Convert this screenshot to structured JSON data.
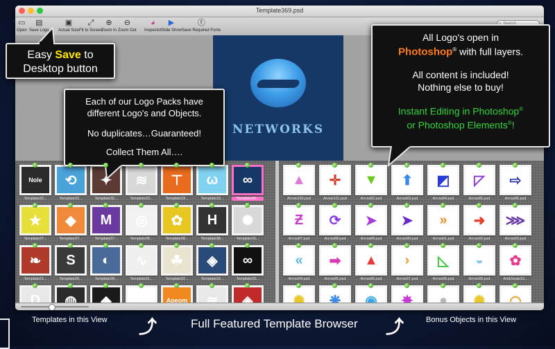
{
  "window": {
    "title": "Template369.psd",
    "search_placeholder": "Search",
    "traffic_lights": {
      "close": "#ff5f57",
      "minimize": "#ffbd2e",
      "zoom": "#28c840"
    }
  },
  "toolbar": {
    "buttons": [
      {
        "label": "Open",
        "icon": "folder-icon"
      },
      {
        "label": "Save Logo",
        "icon": "save-icon"
      },
      {
        "label": "Actual Size",
        "icon": "actual-size-icon"
      },
      {
        "label": "Fit to Screen",
        "icon": "fit-screen-icon"
      },
      {
        "label": "Zoom In",
        "icon": "zoom-in-icon"
      },
      {
        "label": "Zoom Out",
        "icon": "zoom-out-icon"
      },
      {
        "label": "Inspector",
        "icon": "inspector-icon"
      },
      {
        "label": "Slide Show",
        "icon": "slideshow-icon"
      },
      {
        "label": "Save Required Fonts",
        "icon": "fonts-icon"
      }
    ]
  },
  "preview": {
    "logo_text": "NETWORKS",
    "background": "#163866"
  },
  "templates": [
    {
      "caption": "Template32...",
      "color": "#2a2a2a",
      "glyph": "Nole"
    },
    {
      "caption": "Template32...",
      "color": "#4aa3d8",
      "glyph": "⟲"
    },
    {
      "caption": "Template32...",
      "color": "#5a3a33",
      "glyph": "✦"
    },
    {
      "caption": "Template33...",
      "color": "#d8d8d8",
      "glyph": "≋"
    },
    {
      "caption": "Template33...",
      "color": "#e86b1e",
      "glyph": "⊤"
    },
    {
      "caption": "Template33...",
      "color": "#7fd3f0",
      "glyph": "ω"
    },
    {
      "caption": "Template36...",
      "color": "#163866",
      "glyph": "∞",
      "selected": true
    },
    {
      "caption": "Template37...",
      "color": "#e8e03a",
      "glyph": "★"
    },
    {
      "caption": "Template37...",
      "color": "#f08a3a",
      "glyph": "◆"
    },
    {
      "caption": "Template37...",
      "color": "#6a3aa0",
      "glyph": "M"
    },
    {
      "caption": "Template38...",
      "color": "#f2f2f2",
      "glyph": "◎"
    },
    {
      "caption": "Template38...",
      "color": "#e8c820",
      "glyph": "✿"
    },
    {
      "caption": "Template38...",
      "color": "#333333",
      "glyph": "H"
    },
    {
      "caption": "Template15...",
      "color": "#d8d8d8",
      "glyph": "✺"
    },
    {
      "caption": "Template21...",
      "color": "#b03a2a",
      "glyph": "❧"
    },
    {
      "caption": "Template26...",
      "color": "#3a3a3a",
      "glyph": "S"
    },
    {
      "caption": "Template28...",
      "color": "#4a6a9a",
      "glyph": "◐"
    },
    {
      "caption": "Template31...",
      "color": "#f0f0f0",
      "glyph": "∿"
    },
    {
      "caption": "Template32...",
      "color": "#e8e4d0",
      "glyph": "☘"
    },
    {
      "caption": "Template32...",
      "color": "#2a4a7a",
      "glyph": "◈"
    },
    {
      "caption": "Template33...",
      "color": "#111111",
      "glyph": "∞"
    },
    {
      "caption": "Template33...",
      "color": "#e8e8e8",
      "glyph": "D"
    },
    {
      "caption": "",
      "color": "#2a2a2a",
      "glyph": "◍"
    },
    {
      "caption": "",
      "color": "#1a1a1a",
      "glyph": "◆"
    },
    {
      "caption": "",
      "color": "#ffffff",
      "glyph": "▲"
    },
    {
      "caption": "",
      "color": "#f08a20",
      "glyph": "Apeom"
    },
    {
      "caption": "",
      "color": "#e8e8e8",
      "glyph": "≋"
    },
    {
      "caption": "",
      "color": "#c02a2a",
      "glyph": "◈"
    },
    {
      "caption": "",
      "color": "#1a1a1a",
      "glyph": "▼"
    }
  ],
  "objects": [
    {
      "caption": "Arrow100.psd",
      "color": "#ffffff",
      "glyph": "▲",
      "fg": "#e07ad8"
    },
    {
      "caption": "Arrow101.psd",
      "color": "#ffffff",
      "glyph": "✛",
      "fg": "#d83a2a"
    },
    {
      "caption": "Arrow82.psd",
      "color": "#ffffff",
      "glyph": "▼",
      "fg": "#6ac81e"
    },
    {
      "caption": "Arrow83.psd",
      "color": "#ffffff",
      "glyph": "⬆",
      "fg": "#3a8ae8"
    },
    {
      "caption": "Arrow84.psd",
      "color": "#ffffff",
      "glyph": "◩",
      "fg": "#2a3ad8"
    },
    {
      "caption": "Arrow85.psd",
      "color": "#ffffff",
      "glyph": "◸",
      "fg": "#8a3ad8"
    },
    {
      "caption": "Arrow86.psd",
      "color": "#ffffff",
      "glyph": "⇨",
      "fg": "#2a3aa8"
    },
    {
      "caption": "Arrow87.psd",
      "color": "#ffffff",
      "glyph": "Ƶ",
      "fg": "#c83ac8"
    },
    {
      "caption": "Arrow88.psd",
      "color": "#ffffff",
      "glyph": "⟳",
      "fg": "#8a3ae8"
    },
    {
      "caption": "Arrow89.psd",
      "color": "#ffffff",
      "glyph": "➤",
      "fg": "#a83ad8"
    },
    {
      "caption": "Arrow90.psd",
      "color": "#ffffff",
      "glyph": "➤",
      "fg": "#6a2ac8"
    },
    {
      "caption": "Arrow91.psd",
      "color": "#ffffff",
      "glyph": "»",
      "fg": "#e8902a"
    },
    {
      "caption": "Arrow92.psd",
      "color": "#ffffff",
      "glyph": "➜",
      "fg": "#e83a2a"
    },
    {
      "caption": "Arrow93.psd",
      "color": "#ffffff",
      "glyph": "⋙",
      "fg": "#6a3aa8"
    },
    {
      "caption": "Arrow94.psd",
      "color": "#ffffff",
      "glyph": "«",
      "fg": "#5ab8e8"
    },
    {
      "caption": "Arrow95.psd",
      "color": "#ffffff",
      "glyph": "➡",
      "fg": "#d83ab8"
    },
    {
      "caption": "Arrow96.psd",
      "color": "#ffffff",
      "glyph": "▲",
      "fg": "#e83a3a"
    },
    {
      "caption": "Arrow97.psd",
      "color": "#ffffff",
      "glyph": "›",
      "fg": "#e8a02a"
    },
    {
      "caption": "Arrow98.psd",
      "color": "#ffffff",
      "glyph": "◺",
      "fg": "#3ac83a"
    },
    {
      "caption": "Arrow99.psd",
      "color": "#ffffff",
      "glyph": "◒",
      "fg": "#8ac8e8"
    },
    {
      "caption": "Art&Seals10...",
      "color": "#ffffff",
      "glyph": "✿",
      "fg": "#e83a8a"
    },
    {
      "caption": "",
      "color": "#ffffff",
      "glyph": "✺",
      "fg": "#e8c82a"
    },
    {
      "caption": "",
      "color": "#ffffff",
      "glyph": "❋",
      "fg": "#3a8ae8"
    },
    {
      "caption": "",
      "color": "#ffffff",
      "glyph": "◉",
      "fg": "#3aa8e8"
    },
    {
      "caption": "",
      "color": "#ffffff",
      "glyph": "✸",
      "fg": "#c83ad8"
    },
    {
      "caption": "",
      "color": "#ffffff",
      "glyph": "●",
      "fg": "#b8b8b8"
    },
    {
      "caption": "",
      "color": "#ffffff",
      "glyph": "✺",
      "fg": "#e8c82a"
    },
    {
      "caption": "",
      "color": "#ffffff",
      "glyph": "◠",
      "fg": "#e8a02a"
    }
  ],
  "zoom_slider": {
    "position": 0.45
  },
  "callouts": {
    "save": {
      "pre": "Easy ",
      "highlight": "Save",
      "post": " to",
      "line2": "Desktop button"
    },
    "packs": {
      "line1": "Each of our Logo Packs have",
      "line2": "different Logo's and Objects.",
      "line3": "No duplicates…Guaranteed!",
      "line4": "Collect Them All…."
    },
    "logo": {
      "line1": "All Logo's open in",
      "ps": "Photoshop",
      "reg": "®",
      "line2_post": " with full layers.",
      "line3": "All content is included!",
      "line4": "Nothing else to buy!",
      "line5": "Instant Editing in Photoshop",
      "line6": "or Photoshop Elements",
      "line6_end": "!",
      "highlight_color": "#ff7a1a",
      "green_color": "#31d43b"
    }
  },
  "footer": {
    "left": "Templates in this View",
    "center": "Full Featured Template Browser",
    "right": "Bonus Objects in this View"
  }
}
